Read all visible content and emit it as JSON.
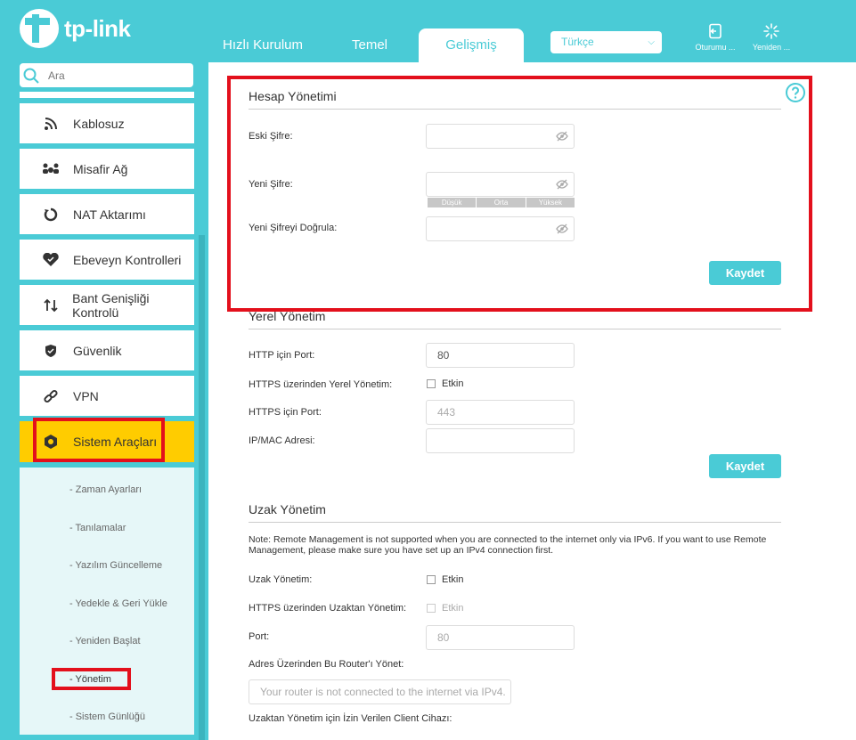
{
  "brand": "tp-link",
  "header": {
    "tabs": [
      {
        "label": "Hızlı Kurulum"
      },
      {
        "label": "Temel"
      },
      {
        "label": "Gelişmiş"
      }
    ],
    "language": "Türkçe",
    "logout_label": "Oturumu ...",
    "reboot_label": "Yeniden ..."
  },
  "sidebar": {
    "search_placeholder": "Ara",
    "items": [
      {
        "label": "Kablosuz",
        "icon": "wifi-icon"
      },
      {
        "label": "Misafir Ağ",
        "icon": "guest-icon"
      },
      {
        "label": "NAT Aktarımı",
        "icon": "nat-icon"
      },
      {
        "label": "Ebeveyn Kontrolleri",
        "icon": "heart-icon"
      },
      {
        "label": "Bant Genişliği Kontrolü",
        "icon": "bandwidth-icon"
      },
      {
        "label": "Güvenlik",
        "icon": "shield-icon"
      },
      {
        "label": "VPN",
        "icon": "vpn-icon"
      },
      {
        "label": "Sistem Araçları",
        "icon": "gear-icon"
      }
    ],
    "subitems": [
      "- Zaman Ayarları",
      "- Tanılamalar",
      "- Yazılım Güncelleme",
      "- Yedekle & Geri Yükle",
      "- Yeniden Başlat",
      "- Yönetim",
      "- Sistem Günlüğü"
    ]
  },
  "account": {
    "title": "Hesap Yönetimi",
    "old_password_label": "Eski Şifre:",
    "new_password_label": "Yeni Şifre:",
    "confirm_password_label": "Yeni Şifreyi Doğrula:",
    "strength": [
      "Düşük",
      "Orta",
      "Yüksek"
    ],
    "save": "Kaydet"
  },
  "local": {
    "title": "Yerel Yönetim",
    "http_port_label": "HTTP için Port:",
    "http_port_value": "80",
    "https_local_label": "HTTPS üzerinden Yerel Yönetim:",
    "https_local_check": "Etkin",
    "https_port_label": "HTTPS için Port:",
    "https_port_value": "443",
    "ipmac_label": "IP/MAC Adresi:",
    "save": "Kaydet"
  },
  "remote": {
    "title": "Uzak Yönetim",
    "note": "Note: Remote Management is not supported when you are connected to the internet only via IPv6. If you want to use Remote Management, please make sure you have set up an IPv4 connection first.",
    "remote_label": "Uzak Yönetim:",
    "remote_check": "Etkin",
    "https_remote_label": "HTTPS üzerinden Uzaktan Yönetim:",
    "https_remote_check": "Etkin",
    "port_label": "Port:",
    "port_value": "80",
    "address_label": "Adres Üzerinden Bu Router'ı Yönet:",
    "address_placeholder": "Your router is not connected to the internet via IPv4.",
    "client_label": "Uzaktan Yönetim için İzin Verilen Client Cihazı:"
  },
  "colors": {
    "accent": "#4acbd6",
    "active": "#ffcc00",
    "highlight": "#e3101c"
  }
}
